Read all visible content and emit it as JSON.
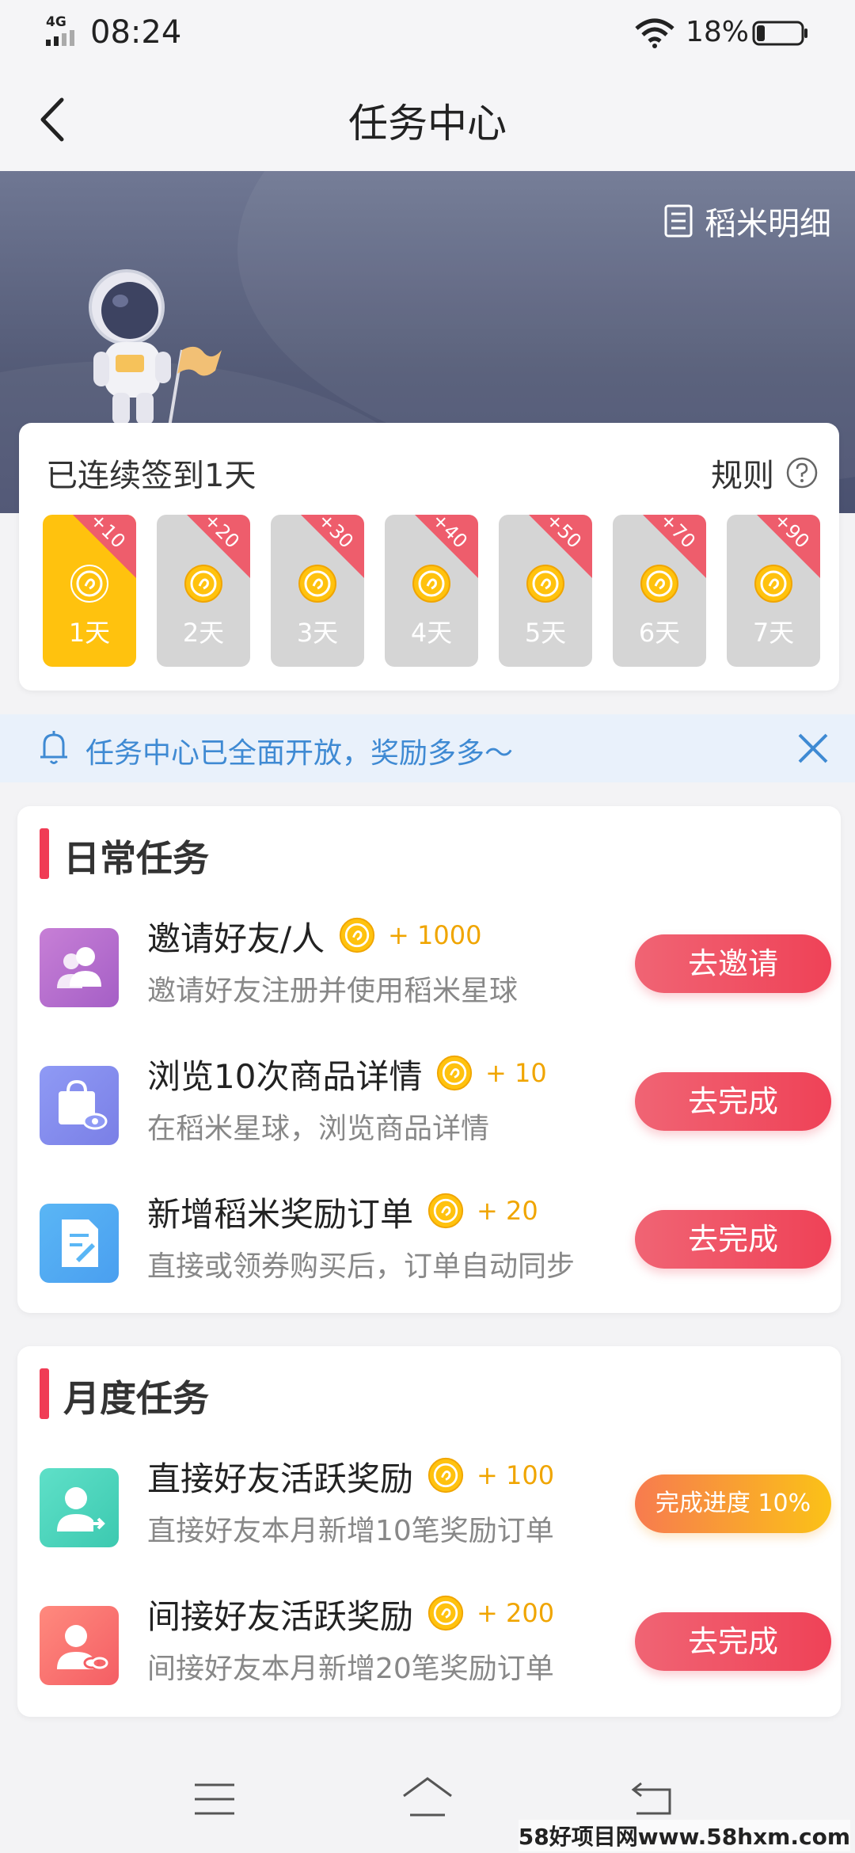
{
  "status_bar": {
    "network": "4G",
    "time": "08:24",
    "battery": "18%"
  },
  "nav": {
    "title": "任务中心"
  },
  "banner": {
    "detail_label": "稻米明细"
  },
  "checkin": {
    "title": "已连续签到1天",
    "rules_label": "规则",
    "days": [
      {
        "label": "1天",
        "bonus": "+10",
        "active": true
      },
      {
        "label": "2天",
        "bonus": "+20",
        "active": false
      },
      {
        "label": "3天",
        "bonus": "+30",
        "active": false
      },
      {
        "label": "4天",
        "bonus": "+40",
        "active": false
      },
      {
        "label": "5天",
        "bonus": "+50",
        "active": false
      },
      {
        "label": "6天",
        "bonus": "+70",
        "active": false
      },
      {
        "label": "7天",
        "bonus": "+90",
        "active": false
      }
    ]
  },
  "notice": {
    "text": "任务中心已全面开放，奖励多多～"
  },
  "daily": {
    "title": "日常任务",
    "tasks": [
      {
        "name": "邀请好友/人",
        "reward": "+ 1000",
        "desc": "邀请好友注册并使用稻米星球",
        "button": "去邀请",
        "icon": "users-icon"
      },
      {
        "name": "浏览10次商品详情",
        "reward": "+ 10",
        "desc": "在稻米星球，浏览商品详情",
        "button": "去完成",
        "icon": "shopping-bag-view-icon"
      },
      {
        "name": "新增稻米奖励订单",
        "reward": "+ 20",
        "desc": "直接或领券购买后，订单自动同步",
        "button": "去完成",
        "icon": "order-document-icon"
      }
    ]
  },
  "monthly": {
    "title": "月度任务",
    "tasks": [
      {
        "name": "直接好友活跃奖励",
        "reward": "+ 100",
        "desc": "直接好友本月新增10笔奖励订单",
        "button": "完成进度 10%",
        "progress": 0.1,
        "icon": "user-share-icon"
      },
      {
        "name": "间接好友活跃奖励",
        "reward": "+ 200",
        "desc": "间接好友本月新增20笔奖励订单",
        "button": "去完成",
        "icon": "user-link-icon"
      }
    ]
  },
  "watermark": "58好项目网www.58hxm.com",
  "colors": {
    "accent_red": "#ef4257",
    "gold": "#f0a500",
    "coin": "#ffc20e",
    "notice_blue": "#3f8ad3"
  }
}
